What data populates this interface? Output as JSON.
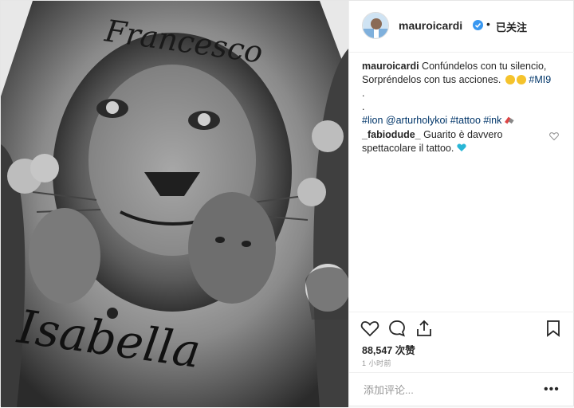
{
  "post": {
    "username": "mauroicardi",
    "follow_status": "已关注",
    "dot": "•",
    "caption_lines": [
      "Confúndelos con tu silencio,",
      "Sorpréndelos con tus acciones."
    ],
    "caption_tag": "#MI9",
    "caption_dots": [
      ".",
      "."
    ],
    "tags": [
      "#lion",
      "@arturholykoi",
      "#tattoo",
      "#ink"
    ],
    "comment": {
      "username": "_fabiodude_",
      "text_line1": "Guarito è davvero",
      "text_line2": "spettacolare il tattoo."
    },
    "likes": "88,547 次赞",
    "time": "1 小时前",
    "add_comment_placeholder": "添加评论...",
    "more": "•••"
  },
  "photo": {
    "top_script": "Francesco",
    "bottom_script": "Isabella"
  },
  "colors": {
    "link": "#003569",
    "verified": "#3897f0"
  }
}
